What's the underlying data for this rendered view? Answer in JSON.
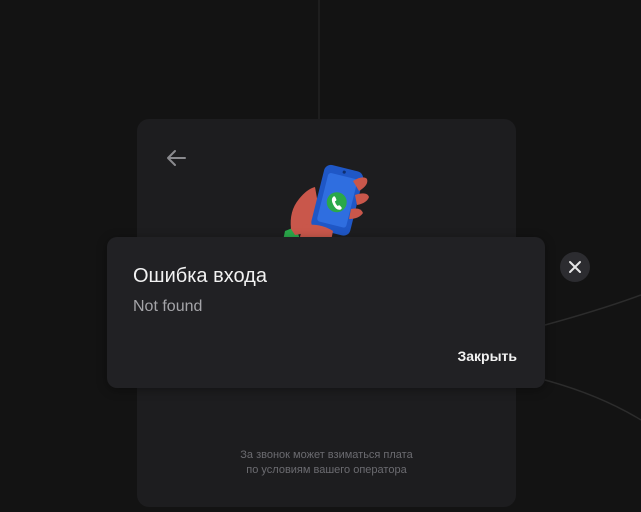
{
  "dialog": {
    "title": "Ошибка входа",
    "message": "Not found",
    "close_label": "Закрыть"
  },
  "login_card": {
    "disclaimer_line1": "За звонок может взиматься плата",
    "disclaimer_line2": "по условиям вашего оператора"
  },
  "icons": {
    "back": "arrow-left-icon",
    "close": "close-icon",
    "illustration": "phone-call-illustration"
  },
  "colors": {
    "background": "#131313",
    "card": "#1d1d1f",
    "dialog": "#212124",
    "phone_blue": "#1f57c6",
    "call_green": "#2aa84a",
    "hand_skin": "#c9574b"
  }
}
